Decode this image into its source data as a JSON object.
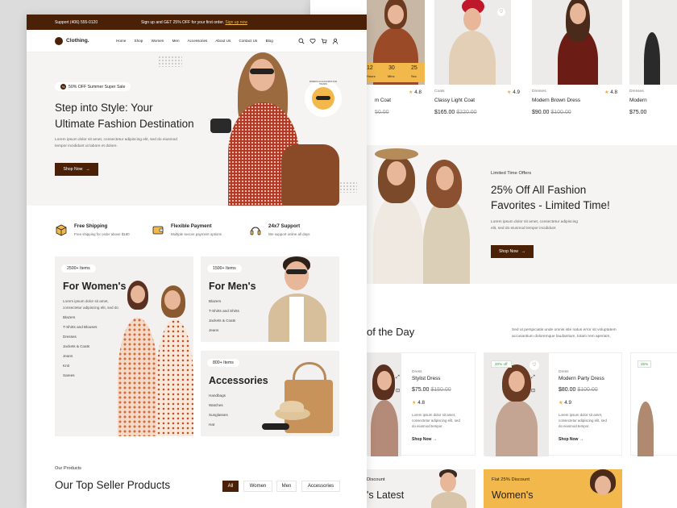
{
  "topbar": {
    "support": "Support (406) 555-0120",
    "promo_prefix": "Sign up and GET 25% OFF for your first order.",
    "promo_link": "Sign up now"
  },
  "brand": {
    "name": "Clothing."
  },
  "nav": {
    "items": [
      "Home",
      "Shop",
      "Women",
      "Men",
      "Accessories",
      "About Us",
      "Contact Us",
      "Blog"
    ]
  },
  "hero": {
    "badge": "50% OFF Summer Super Sale",
    "title_line1": "Step into Style: Your",
    "title_line2": "Ultimate Fashion Destination",
    "desc_line1": "Lorem ipsum dolor sit amet, consectetur adipiscing elit, sed do eiusmod",
    "desc_line2": "tempor incididunt ut labore et dolore.",
    "button": "Shop Now",
    "circle_text": "MODERN ACCESSORIES FOR TRENDS"
  },
  "features": [
    {
      "title": "Free Shipping",
      "sub": "Free shipping for order above $180"
    },
    {
      "title": "Flexible Payment",
      "sub": "Multiple secure payment options"
    },
    {
      "title": "24x7 Support",
      "sub": "We support online all days"
    }
  ],
  "categories": {
    "women": {
      "count": "2500+ Items",
      "title": "For Women's",
      "desc_line1": "Lorem ipsum dolor sit amet,",
      "desc_line2": "consectetur adipiscing elit, sed do",
      "items": [
        "Blazers",
        "T-Shirts and Blouses",
        "Dresses",
        "Jackets & Coats",
        "Jeans",
        "Knit",
        "Sarees"
      ]
    },
    "men": {
      "count": "1500+ Items",
      "title": "For Men's",
      "items": [
        "Blazers",
        "T-Shirts and Shirts",
        "Jackets & Coats",
        "Jeans"
      ]
    },
    "acc": {
      "count": "800+ Items",
      "title": "Accessories",
      "items": [
        "Handbags",
        "Watches",
        "Sunglasses",
        "Hat"
      ]
    }
  },
  "products": {
    "eyebrow": "Our Products",
    "title": "Our Top Seller Products",
    "tabs": [
      "All",
      "Women",
      "Men",
      "Accessories"
    ]
  },
  "back_top": [
    {
      "cat": "",
      "name": "m Coat",
      "rating": "4.8",
      "price": "",
      "old": "50.00",
      "countdown": [
        "12",
        "30",
        "25"
      ],
      "count_labels": [
        "Hours",
        "Mins",
        "Sec"
      ]
    },
    {
      "cat": "Coats",
      "name": "Classy Light Coat",
      "rating": "4.9",
      "price": "$165.00",
      "old": "$220.00"
    },
    {
      "cat": "Dresses",
      "name": "Modern Brown Dress",
      "rating": "4.8",
      "price": "$90.00",
      "old": "$100.00"
    },
    {
      "cat": "Dresses",
      "name": "Modern",
      "price": "$75.00"
    }
  ],
  "offer": {
    "eyebrow": "Limited Time Offers",
    "title_line1": "25% Off All Fashion",
    "title_line2": "Favorites - Limited Time!",
    "desc_line1": "Lorem ipsum dolor sit amet, consectetur adipiscing",
    "desc_line2": "elit, sed do eiusmod tempor incididunt",
    "button": "Shop Now"
  },
  "deal": {
    "title": "of the Day",
    "desc_line1": "Sed ut perspiciatis unde omnis iste natus error sit voluptatem",
    "desc_line2": "accusantium doloremque laudantium, totam rem aperiam,"
  },
  "deal_cards": [
    {
      "cat": "Dress",
      "name": "Stylist Dress",
      "price": "$75.00",
      "old": "$150.00",
      "rating": "4.8",
      "desc_line1": "Lorem ipsum dolor sit amet,",
      "desc_line2": "consectetur adipiscing elit, sed",
      "desc_line3": "do eiusmod tempor.",
      "cta": "Shop Now"
    },
    {
      "badge": "20% off",
      "cat": "Dress",
      "name": "Modern Party Dress",
      "price": "$80.00",
      "old": "$100.00",
      "rating": "4.9",
      "desc_line1": "Lorem ipsum dolor sit amet,",
      "desc_line2": "consectetur adipiscing elit, sed",
      "desc_line3": "do eiusmod tempor.",
      "cta": "Shop Now"
    },
    {
      "badge": "25%"
    }
  ],
  "bottom_banners": [
    {
      "eyebrow": "Discount",
      "title": "'s Latest"
    },
    {
      "eyebrow": "Flat 25% Discount",
      "title": "Women's"
    }
  ],
  "colors": {
    "brand": "#4a2107",
    "accent": "#f2b84b",
    "star": "#f2a93b"
  }
}
